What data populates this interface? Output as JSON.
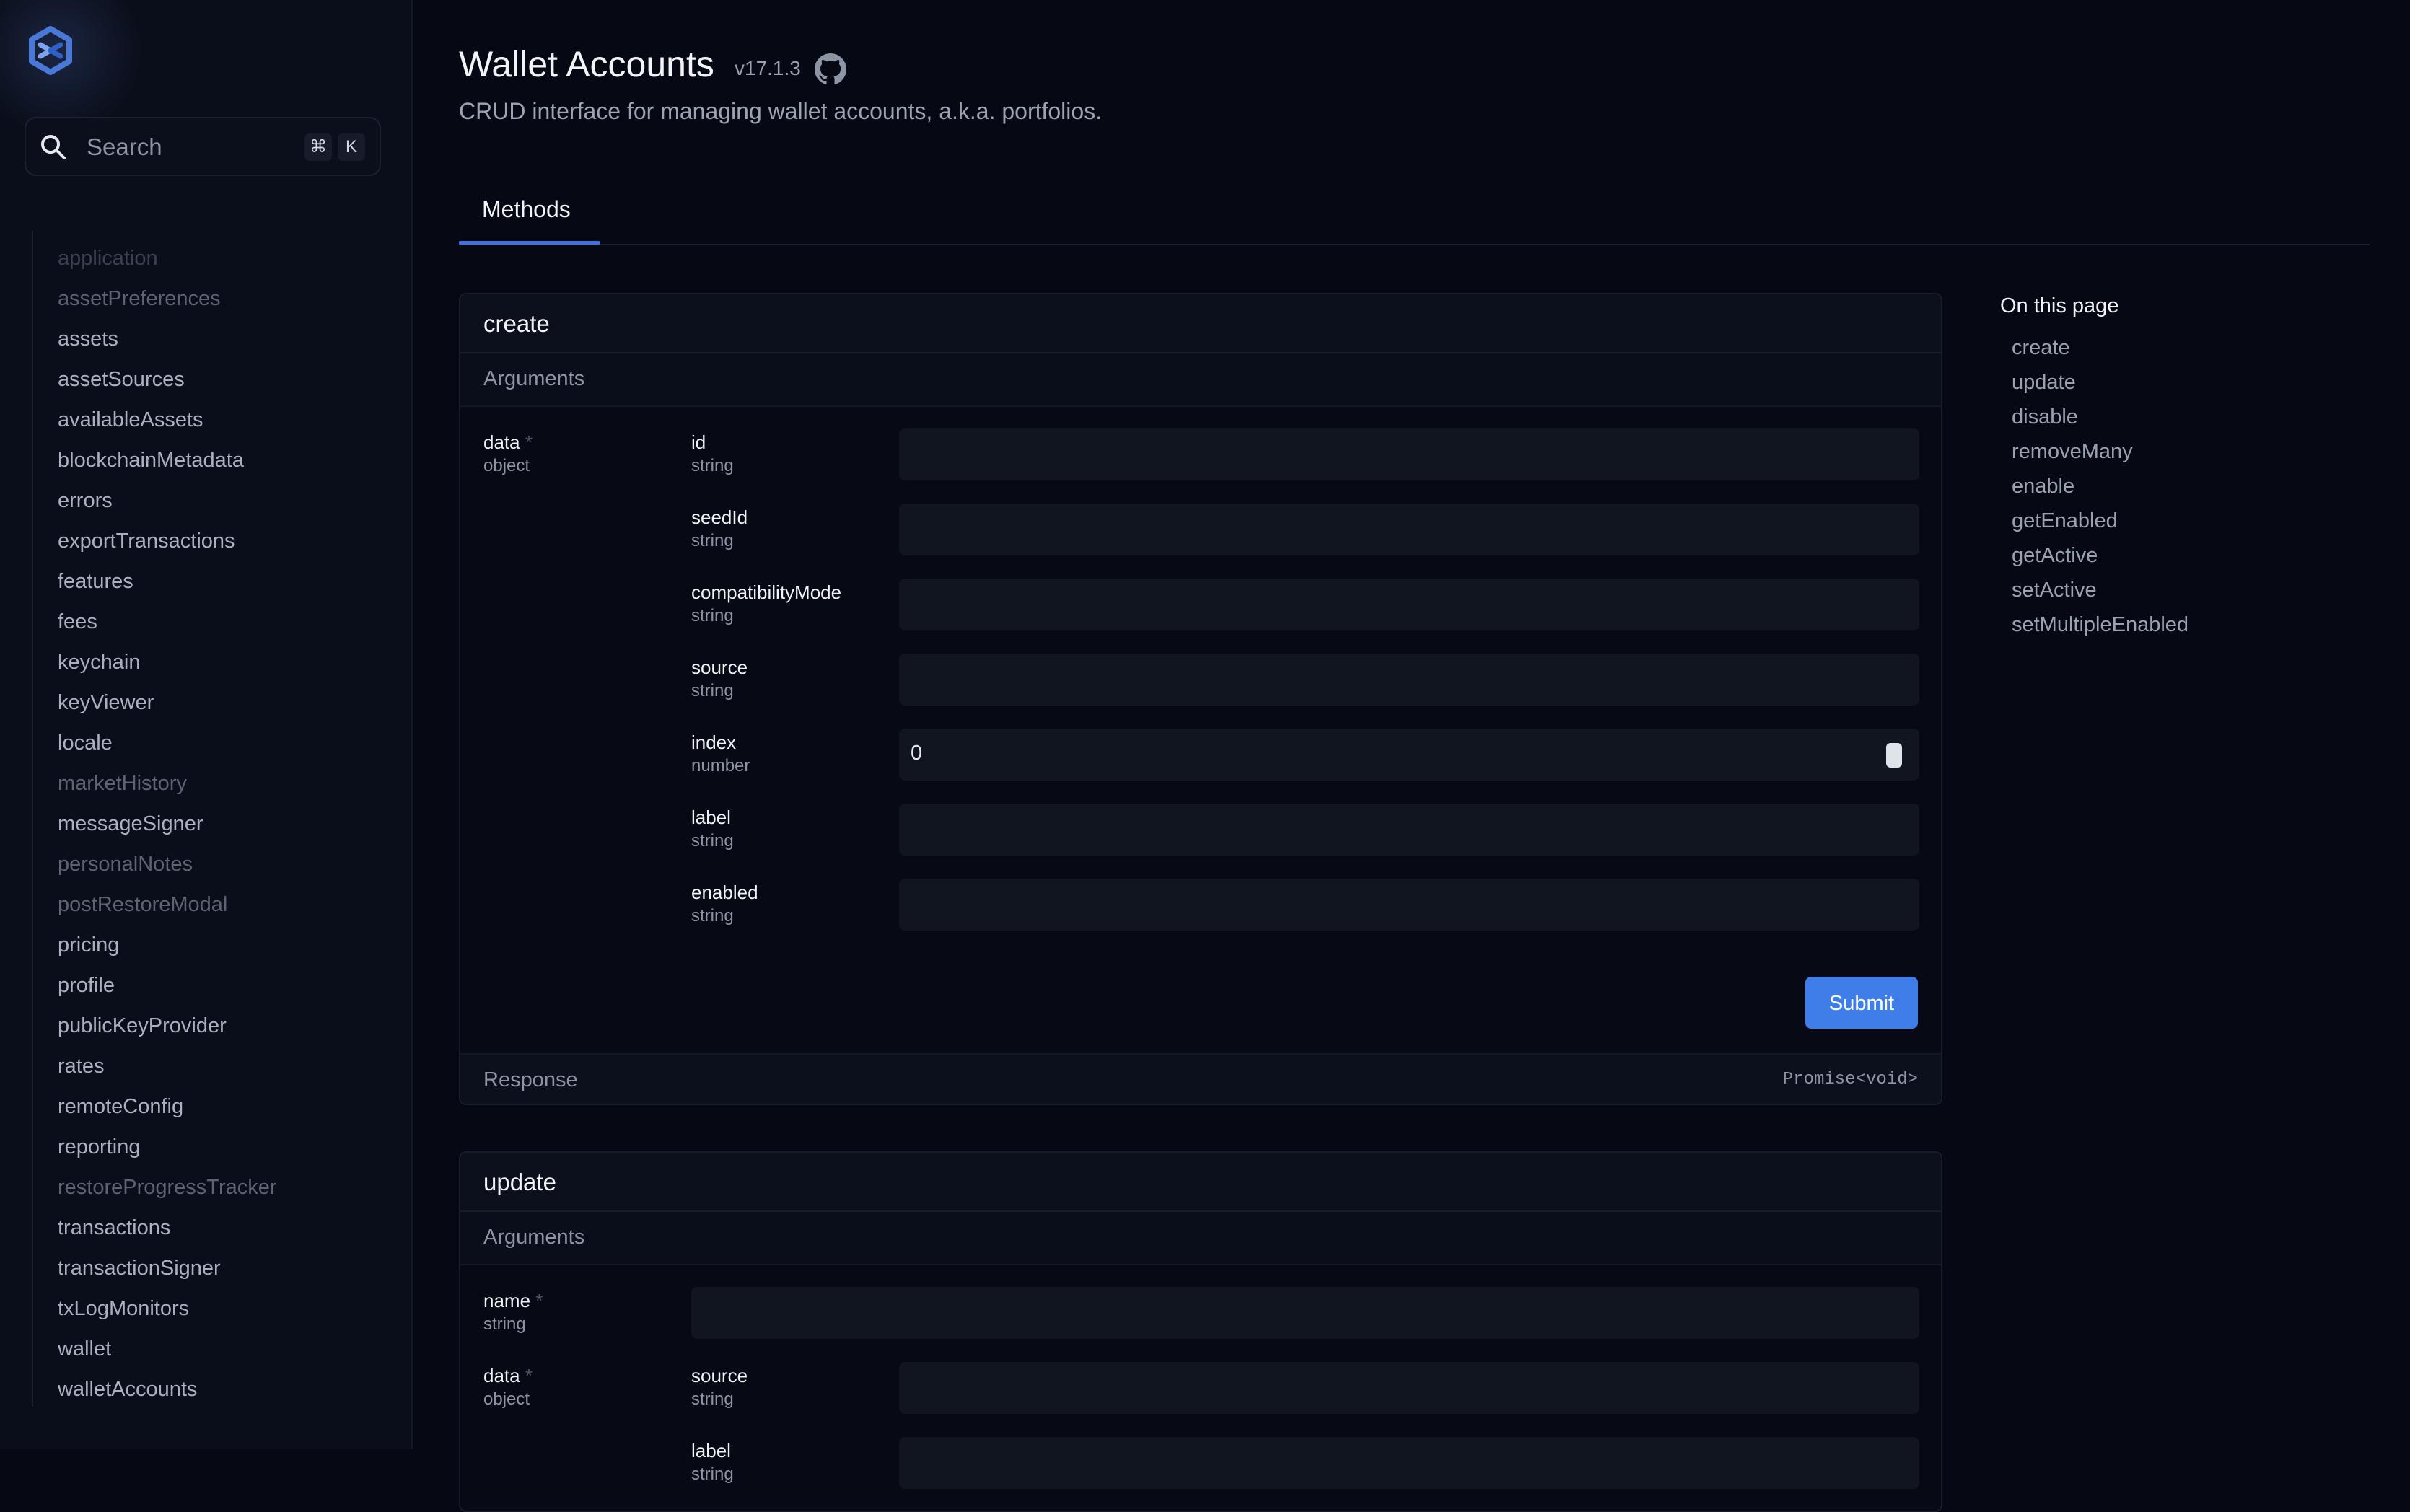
{
  "sidebar": {
    "search_placeholder": "Search",
    "shortcut_mod": "⌘",
    "shortcut_key": "K",
    "items": [
      {
        "label": "application",
        "state": "faint"
      },
      {
        "label": "assetPreferences",
        "state": "dim"
      },
      {
        "label": "assets",
        "state": "normal"
      },
      {
        "label": "assetSources",
        "state": "normal"
      },
      {
        "label": "availableAssets",
        "state": "normal"
      },
      {
        "label": "blockchainMetadata",
        "state": "normal"
      },
      {
        "label": "errors",
        "state": "normal"
      },
      {
        "label": "exportTransactions",
        "state": "normal"
      },
      {
        "label": "features",
        "state": "normal"
      },
      {
        "label": "fees",
        "state": "normal"
      },
      {
        "label": "keychain",
        "state": "normal"
      },
      {
        "label": "keyViewer",
        "state": "normal"
      },
      {
        "label": "locale",
        "state": "normal"
      },
      {
        "label": "marketHistory",
        "state": "dim"
      },
      {
        "label": "messageSigner",
        "state": "normal"
      },
      {
        "label": "personalNotes",
        "state": "dim"
      },
      {
        "label": "postRestoreModal",
        "state": "dim"
      },
      {
        "label": "pricing",
        "state": "normal"
      },
      {
        "label": "profile",
        "state": "normal"
      },
      {
        "label": "publicKeyProvider",
        "state": "normal"
      },
      {
        "label": "rates",
        "state": "normal"
      },
      {
        "label": "remoteConfig",
        "state": "normal"
      },
      {
        "label": "reporting",
        "state": "normal"
      },
      {
        "label": "restoreProgressTracker",
        "state": "dim"
      },
      {
        "label": "transactions",
        "state": "normal"
      },
      {
        "label": "transactionSigner",
        "state": "normal"
      },
      {
        "label": "txLogMonitors",
        "state": "normal"
      },
      {
        "label": "wallet",
        "state": "normal"
      },
      {
        "label": "walletAccounts",
        "state": "normal"
      }
    ]
  },
  "header": {
    "title": "Wallet Accounts",
    "version": "v17.1.3",
    "subtitle": "CRUD interface for managing wallet accounts, a.k.a. portfolios.",
    "tab": "Methods"
  },
  "create": {
    "name": "create",
    "arguments_label": "Arguments",
    "param": {
      "label": "data",
      "required": "*",
      "type": "object"
    },
    "fields": [
      {
        "label": "id",
        "type": "string",
        "value": ""
      },
      {
        "label": "seedId",
        "type": "string",
        "value": ""
      },
      {
        "label": "compatibilityMode",
        "type": "string",
        "value": ""
      },
      {
        "label": "source",
        "type": "string",
        "value": ""
      },
      {
        "label": "index",
        "type": "number",
        "value": "0"
      },
      {
        "label": "label",
        "type": "string",
        "value": ""
      },
      {
        "label": "enabled",
        "type": "string",
        "value": ""
      }
    ],
    "submit": "Submit",
    "response_label": "Response",
    "response_type": "Promise<void>"
  },
  "update": {
    "name": "update",
    "arguments_label": "Arguments",
    "name_param": {
      "label": "name",
      "required": "*",
      "type": "string",
      "value": ""
    },
    "data_param": {
      "label": "data",
      "required": "*",
      "type": "object"
    },
    "fields": [
      {
        "label": "source",
        "type": "string",
        "value": ""
      },
      {
        "label": "label",
        "type": "string",
        "value": ""
      }
    ]
  },
  "toc": {
    "title": "On this page",
    "items": [
      "create",
      "update",
      "disable",
      "removeMany",
      "enable",
      "getEnabled",
      "getActive",
      "setActive",
      "setMultipleEnabled"
    ]
  },
  "colors": {
    "background": "#060914",
    "accent": "#3f7de8",
    "tab_underline": "#3f72e0"
  }
}
